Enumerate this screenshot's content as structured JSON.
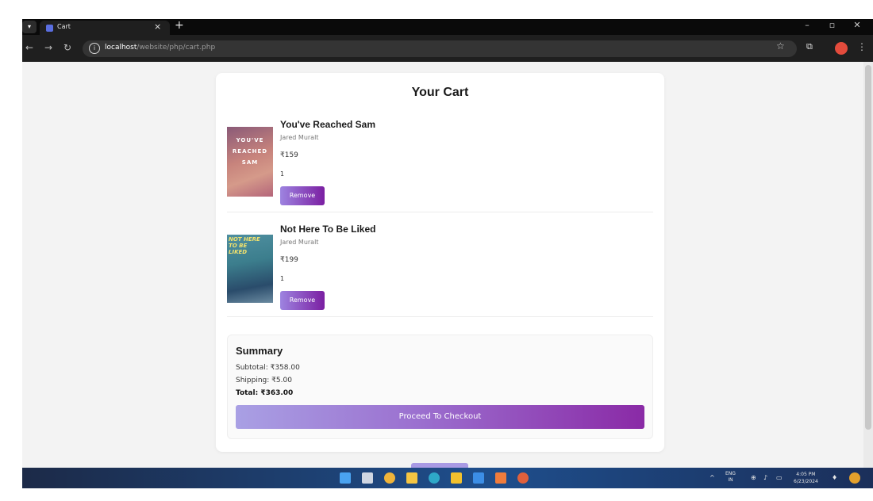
{
  "browser": {
    "tab_title": "Cart",
    "tab_close": "×",
    "tab_new": "+",
    "url_host": "localhost",
    "url_path": "/website/php/cart.php",
    "win_min": "–",
    "win_max": "▫",
    "win_close": "✕"
  },
  "cart": {
    "title": "Your Cart",
    "items": [
      {
        "title": "You've Reached Sam",
        "author": "Jared Muralt",
        "price": "₹159",
        "quantity": "1",
        "remove_label": "Remove",
        "cover_text": "YOU'VE REACHED SAM"
      },
      {
        "title": "Not Here To Be Liked",
        "author": "Jared Muralt",
        "price": "₹199",
        "quantity": "1",
        "remove_label": "Remove",
        "cover_text": "NOT HERE TO BE LIKED"
      }
    ]
  },
  "summary": {
    "title": "Summary",
    "subtotal": "Subtotal: ₹358.00",
    "shipping": "Shipping: ₹5.00",
    "total": "Total: ₹363.00",
    "checkout_label": "Proceed To Checkout"
  },
  "taskbar": {
    "lang_top": "ENG",
    "lang_bottom": "IN",
    "time": "4:05 PM",
    "date": "6/23/2024"
  },
  "colors": {
    "accent_start": "#a9a0e4",
    "accent_end": "#8a2aa6"
  }
}
